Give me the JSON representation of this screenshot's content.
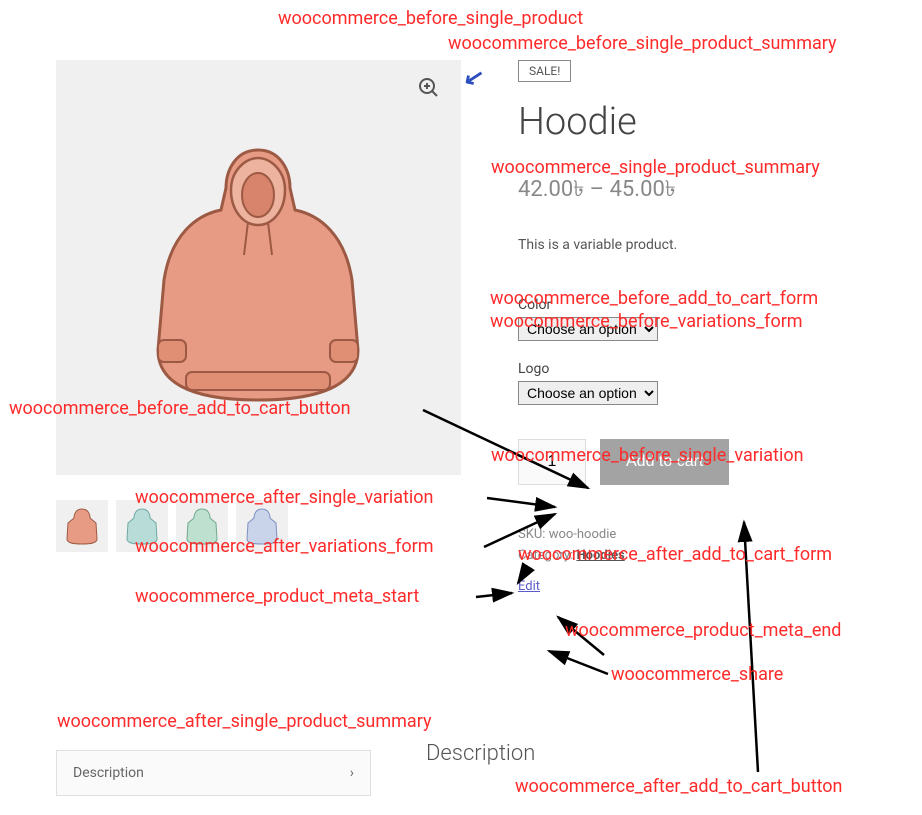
{
  "hooks": {
    "before_single_product": "woocommerce_before_single_product",
    "before_single_product_summary": "woocommerce_before_single_product_summary",
    "single_product_summary": "woocommerce_single_product_summary",
    "before_add_to_cart_form": "woocommerce_before_add_to_cart_form",
    "before_variations_form": "woocommerce_before_variations_form",
    "before_add_to_cart_button": "woocommerce_before_add_to_cart_button",
    "before_single_variation": "woocommerce_before_single_variation",
    "after_single_variation": "woocommerce_after_single_variation",
    "after_variations_form": "woocommerce_after_variations_form",
    "after_add_to_cart_form": "woocommerce_after_add_to_cart_form",
    "product_meta_start": "woocommerce_product_meta_start",
    "product_meta_end": "woocommerce_product_meta_end",
    "share": "woocommerce_share",
    "after_single_product_summary": "woocommerce_after_single_product_summary",
    "after_add_to_cart_button": "woocommerce_after_add_to_cart_button"
  },
  "product": {
    "sale_label": "SALE!",
    "title": "Hoodie",
    "price": "42.00৳ – 45.00৳",
    "short_description": "This is a variable product.",
    "variations": {
      "color_label": "Color",
      "color_placeholder": "Choose an option",
      "logo_label": "Logo",
      "logo_placeholder": "Choose an option"
    },
    "quantity": "1",
    "add_to_cart_label": "Add to cart",
    "meta": {
      "sku_label": "SKU:",
      "sku_value": "woo-hoodie",
      "category_label": "Category:",
      "category_value": "Hoodies"
    },
    "edit_label": "Edit"
  },
  "tabs": {
    "heading": "Description",
    "items": [
      {
        "label": "Description"
      }
    ]
  }
}
